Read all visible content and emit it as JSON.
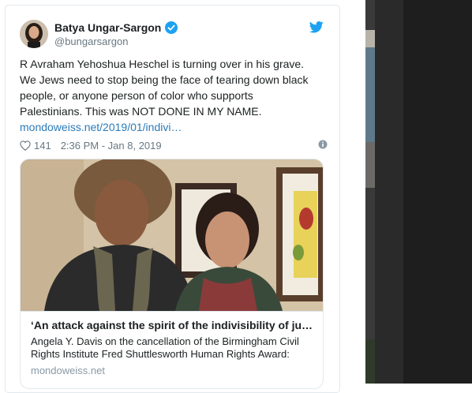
{
  "tweet": {
    "author_name": "Batya Ungar-Sargon",
    "author_handle": "@bungarsargon",
    "text_lines": [
      "R Avraham Yehoshua Heschel is turning over in his grave.",
      "We Jews need to stop being the face of tearing down black",
      "people, or anyone person of color who supports",
      "Palestinians. This was NOT DONE IN MY NAME."
    ],
    "link_text": "mondoweiss.net/2019/01/indivi…",
    "likes": "141",
    "timestamp": "2:36 PM - Jan 8, 2019"
  },
  "card": {
    "title": "‘An attack against the spirit of the indivisibility of justi…",
    "description": "Angela Y. Davis on the cancellation of the Birmingham Civil Rights Institute Fred Shuttlesworth Human Rights Award:",
    "domain": "mondoweiss.net"
  },
  "icons": {
    "verified": "verified-badge-icon",
    "brand": "twitter-bird-icon",
    "like": "heart-icon",
    "info": "info-icon"
  },
  "colors": {
    "accent": "#1da1f2",
    "link": "#2b7bb9",
    "muted": "#697882",
    "text": "#1c2022"
  }
}
